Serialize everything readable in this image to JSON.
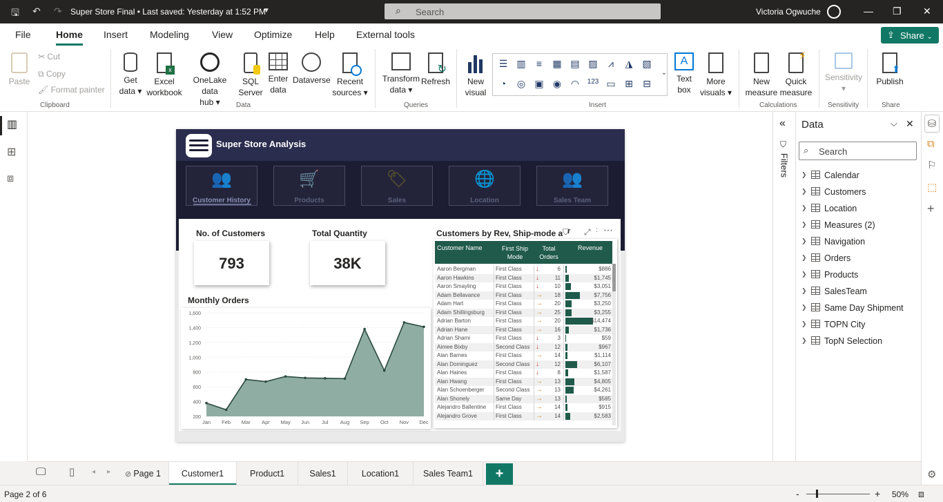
{
  "titlebar": {
    "doc_title": "Super Store Final • Last saved: Yesterday at 1:52 PM",
    "search_placeholder": "Search",
    "user_name": "Victoria Ogwuche"
  },
  "menu": {
    "items": [
      "File",
      "Home",
      "Insert",
      "Modeling",
      "View",
      "Optimize",
      "Help",
      "External tools"
    ],
    "active": "Home",
    "share_label": "Share"
  },
  "ribbon": {
    "clipboard": {
      "paste": "Paste",
      "cut": "Cut",
      "copy": "Copy",
      "format_painter": "Format painter",
      "label": "Clipboard"
    },
    "data": {
      "get_data": [
        "Get",
        "data ▾"
      ],
      "excel": [
        "Excel",
        "workbook"
      ],
      "onelake": [
        "OneLake data",
        "hub ▾"
      ],
      "sql": [
        "SQL",
        "Server"
      ],
      "enter_data": [
        "Enter",
        "data"
      ],
      "dataverse": "Dataverse",
      "recent": [
        "Recent",
        "sources ▾"
      ],
      "label": "Data"
    },
    "queries": {
      "transform": [
        "Transform",
        "data ▾"
      ],
      "refresh": "Refresh",
      "label": "Queries"
    },
    "insert": {
      "new_visual": [
        "New",
        "visual"
      ],
      "text_box": [
        "Text",
        "box"
      ],
      "more_visuals": [
        "More",
        "visuals ▾"
      ],
      "label": "Insert"
    },
    "calculations": {
      "new_measure": [
        "New",
        "measure"
      ],
      "quick_measure": [
        "Quick",
        "measure"
      ],
      "label": "Calculations"
    },
    "sensitivity": {
      "btn": [
        "Sensitivity",
        "▾"
      ],
      "label": "Sensitivity"
    },
    "share": {
      "publish": "Publish",
      "label": "Share"
    }
  },
  "report": {
    "title": "Super Store Analysis",
    "nav_tiles": [
      "Customer History",
      "Products",
      "Sales",
      "Location",
      "Sales Team"
    ],
    "kpis": [
      {
        "label": "No. of Customers",
        "value": "793"
      },
      {
        "label": "Total Quantity",
        "value": "38K"
      }
    ],
    "table_title": "Customers by Rev, Ship-mode ar",
    "table": {
      "headers": [
        "Customer Name",
        "First Ship Mode",
        "Total Orders",
        "Revenue"
      ],
      "rows": [
        {
          "name": "Aaron Bergman",
          "mode": "First Class",
          "dir": "down",
          "orders": "6",
          "revenue": "$886",
          "rev_num": 886
        },
        {
          "name": "Aaron Hawkins",
          "mode": "First Class",
          "dir": "down",
          "orders": "11",
          "revenue": "$1,745",
          "rev_num": 1745
        },
        {
          "name": "Aaron Smayling",
          "mode": "First Class",
          "dir": "down",
          "orders": "10",
          "revenue": "$3,051",
          "rev_num": 3051
        },
        {
          "name": "Adam Bellavance",
          "mode": "First Class",
          "dir": "right",
          "orders": "18",
          "revenue": "$7,756",
          "rev_num": 7756
        },
        {
          "name": "Adam Hart",
          "mode": "First Class",
          "dir": "right",
          "orders": "20",
          "revenue": "$3,250",
          "rev_num": 3250
        },
        {
          "name": "Adam Shillingsburg",
          "mode": "First Class",
          "dir": "right",
          "orders": "25",
          "revenue": "$3,255",
          "rev_num": 3255
        },
        {
          "name": "Adrian Barton",
          "mode": "First Class",
          "dir": "right",
          "orders": "20",
          "revenue": "$14,474",
          "rev_num": 14474
        },
        {
          "name": "Adrian Hane",
          "mode": "First Class",
          "dir": "right",
          "orders": "16",
          "revenue": "$1,736",
          "rev_num": 1736
        },
        {
          "name": "Adrian Shami",
          "mode": "First Class",
          "dir": "down",
          "orders": "3",
          "revenue": "$59",
          "rev_num": 59
        },
        {
          "name": "Aimee Bixby",
          "mode": "Second Class",
          "dir": "down",
          "orders": "12",
          "revenue": "$967",
          "rev_num": 967
        },
        {
          "name": "Alan Barnes",
          "mode": "First Class",
          "dir": "right",
          "orders": "14",
          "revenue": "$1,114",
          "rev_num": 1114
        },
        {
          "name": "Alan Dominguez",
          "mode": "Second Class",
          "dir": "down",
          "orders": "12",
          "revenue": "$6,107",
          "rev_num": 6107
        },
        {
          "name": "Alan Haines",
          "mode": "First Class",
          "dir": "down",
          "orders": "8",
          "revenue": "$1,587",
          "rev_num": 1587
        },
        {
          "name": "Alan Hwang",
          "mode": "First Class",
          "dir": "right",
          "orders": "13",
          "revenue": "$4,805",
          "rev_num": 4805
        },
        {
          "name": "Alan Schoenberger",
          "mode": "Second Class",
          "dir": "right",
          "orders": "13",
          "revenue": "$4,261",
          "rev_num": 4261
        },
        {
          "name": "Alan Shonely",
          "mode": "Same Day",
          "dir": "right",
          "orders": "13",
          "revenue": "$585",
          "rev_num": 585
        },
        {
          "name": "Alejandro Ballentine",
          "mode": "First Class",
          "dir": "right",
          "orders": "14",
          "revenue": "$915",
          "rev_num": 915
        },
        {
          "name": "Alejandro Grove",
          "mode": "First Class",
          "dir": "right",
          "orders": "14",
          "revenue": "$2,583",
          "rev_num": 2583
        }
      ]
    }
  },
  "chart_data": {
    "type": "area",
    "title": "Monthly Orders",
    "categories": [
      "Jan",
      "Feb",
      "Mar",
      "Apr",
      "May",
      "Jun",
      "Jul",
      "Aug",
      "Sep",
      "Oct",
      "Nov",
      "Dec"
    ],
    "values": [
      380,
      290,
      700,
      670,
      740,
      720,
      715,
      710,
      1380,
      820,
      1470,
      1410
    ],
    "ylim": [
      200,
      1600
    ],
    "yticks": [
      "1,600",
      "1,400",
      "1,200",
      "1,000",
      "800",
      "600",
      "400",
      "200"
    ],
    "fill_color": "#8fada3",
    "line_color": "#2b4a3f"
  },
  "filters_label": "Filters",
  "data_pane": {
    "title": "Data",
    "search_placeholder": "Search",
    "tables": [
      "Calendar",
      "Customers",
      "Location",
      "Measures (2)",
      "Navigation",
      "Orders",
      "Products",
      "SalesTeam",
      "Same Day Shipment",
      "TOPN City",
      "TopN Selection"
    ]
  },
  "tabs": {
    "items": [
      "Page 1",
      "Customer1",
      "Product1",
      "Sales1",
      "Location1",
      "Sales Team1"
    ],
    "active": "Customer1",
    "add_label": "+"
  },
  "status": {
    "page": "Page 2 of 6",
    "zoom": "50%"
  },
  "colors": {
    "accent": "#117865",
    "header_dark": "#2b2d4e",
    "table_header": "#1f5a4a",
    "down_arrow": "#c0392b",
    "right_arrow": "#d4882b"
  }
}
